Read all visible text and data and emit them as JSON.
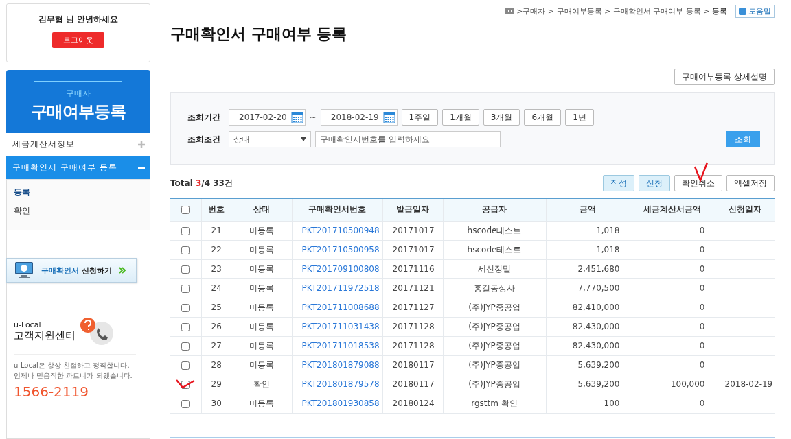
{
  "user": {
    "greeting": "김무협 님 안녕하세요",
    "logout": "로그아웃"
  },
  "sidebar": {
    "subtitle": "구매자",
    "title": "구매여부등록",
    "items": [
      {
        "label": "세금계산서정보",
        "expanded": false
      },
      {
        "label": "구매확인서 구매여부 등록",
        "expanded": true,
        "children": [
          {
            "label": "등록",
            "selected": true
          },
          {
            "label": "확인",
            "selected": false
          }
        ]
      }
    ],
    "apply_banner": {
      "label_part1": "구매확인서",
      "label_part2": "신청하기"
    },
    "support": {
      "brand": "u-Local",
      "title": "고객지원센터",
      "text_line1": "u-Local은 항상 친절하고 정직합니다.",
      "text_line2": "언제나 믿음직한 파트너가 되겠습니다.",
      "phone": "1566-2119"
    }
  },
  "breadcrumb": ">구매자 > 구매여부등록 > 구매확인서 구매여부 등록 > ",
  "breadcrumb_current": "등록",
  "help": "도움말",
  "page_title": "구매확인서 구매여부 등록",
  "detail_button": "구매여부등록 상세설명",
  "search": {
    "period_label": "조회기간",
    "from": "2017-02-20",
    "tilde": "~",
    "to": "2018-02-19",
    "ranges": [
      "1주일",
      "1개월",
      "3개월",
      "6개월",
      "1년"
    ],
    "condition_label": "조회조건",
    "status_select": "상태",
    "placeholder": "구매확인서번호를 입력하세요",
    "search_button": "조회"
  },
  "summary": {
    "label": "Total",
    "selected_count": "3",
    "rest": "/4 33건"
  },
  "actions": [
    {
      "label": "작성",
      "kind": "primary"
    },
    {
      "label": "신청",
      "kind": "primary"
    },
    {
      "label": "확인취소",
      "kind": "plain",
      "marked": true
    },
    {
      "label": "엑셀저장",
      "kind": "plain"
    }
  ],
  "table": {
    "select_all_checked": false,
    "columns": [
      "번호",
      "상태",
      "구매확인서번호",
      "발급일자",
      "공급자",
      "금액",
      "세금계산서금액",
      "신청일자"
    ],
    "rows": [
      {
        "checked": false,
        "no": "21",
        "status": "미등록",
        "id": "PKT201710500948",
        "date": "20171017",
        "supplier": "hscode테스트",
        "amount": "1,018",
        "tax": "0"
      },
      {
        "checked": false,
        "no": "22",
        "status": "미등록",
        "id": "PKT201710500958",
        "date": "20171017",
        "supplier": "hscode테스트",
        "amount": "1,018",
        "tax": "0"
      },
      {
        "checked": false,
        "no": "23",
        "status": "미등록",
        "id": "PKT201709100808",
        "date": "20171116",
        "supplier": "세신정밀",
        "amount": "2,451,680",
        "tax": "0"
      },
      {
        "checked": false,
        "no": "24",
        "status": "미등록",
        "id": "PKT201711972518",
        "date": "20171121",
        "supplier": "홍길동상사",
        "amount": "7,770,500",
        "tax": "0"
      },
      {
        "checked": false,
        "no": "25",
        "status": "미등록",
        "id": "PKT201711008688",
        "date": "20171127",
        "supplier": "(주)JYP중공업",
        "amount": "82,410,000",
        "tax": "0"
      },
      {
        "checked": false,
        "no": "26",
        "status": "미등록",
        "id": "PKT201711031438",
        "date": "20171128",
        "supplier": "(주)JYP중공업",
        "amount": "82,430,000",
        "tax": "0"
      },
      {
        "checked": false,
        "no": "27",
        "status": "미등록",
        "id": "PKT201711018538",
        "date": "20171128",
        "supplier": "(주)JYP중공업",
        "amount": "82,430,000",
        "tax": "0"
      },
      {
        "checked": false,
        "no": "28",
        "status": "미등록",
        "id": "PKT201801879088",
        "date": "20180117",
        "supplier": "(주)JYP중공업",
        "amount": "5,639,200",
        "tax": "0"
      },
      {
        "checked": false,
        "marked": true,
        "no": "29",
        "status": "확인",
        "id": "PKT201801879578",
        "date": "20180117",
        "supplier": "(주)JYP중공업",
        "amount": "5,639,200",
        "tax": "100,000",
        "apply_date": "2018-02-19"
      },
      {
        "checked": false,
        "no": "30",
        "status": "미등록",
        "id": "PKT201801930858",
        "date": "20180124",
        "supplier": "rgsttm 확인",
        "amount": "100",
        "tax": "0"
      }
    ]
  }
}
